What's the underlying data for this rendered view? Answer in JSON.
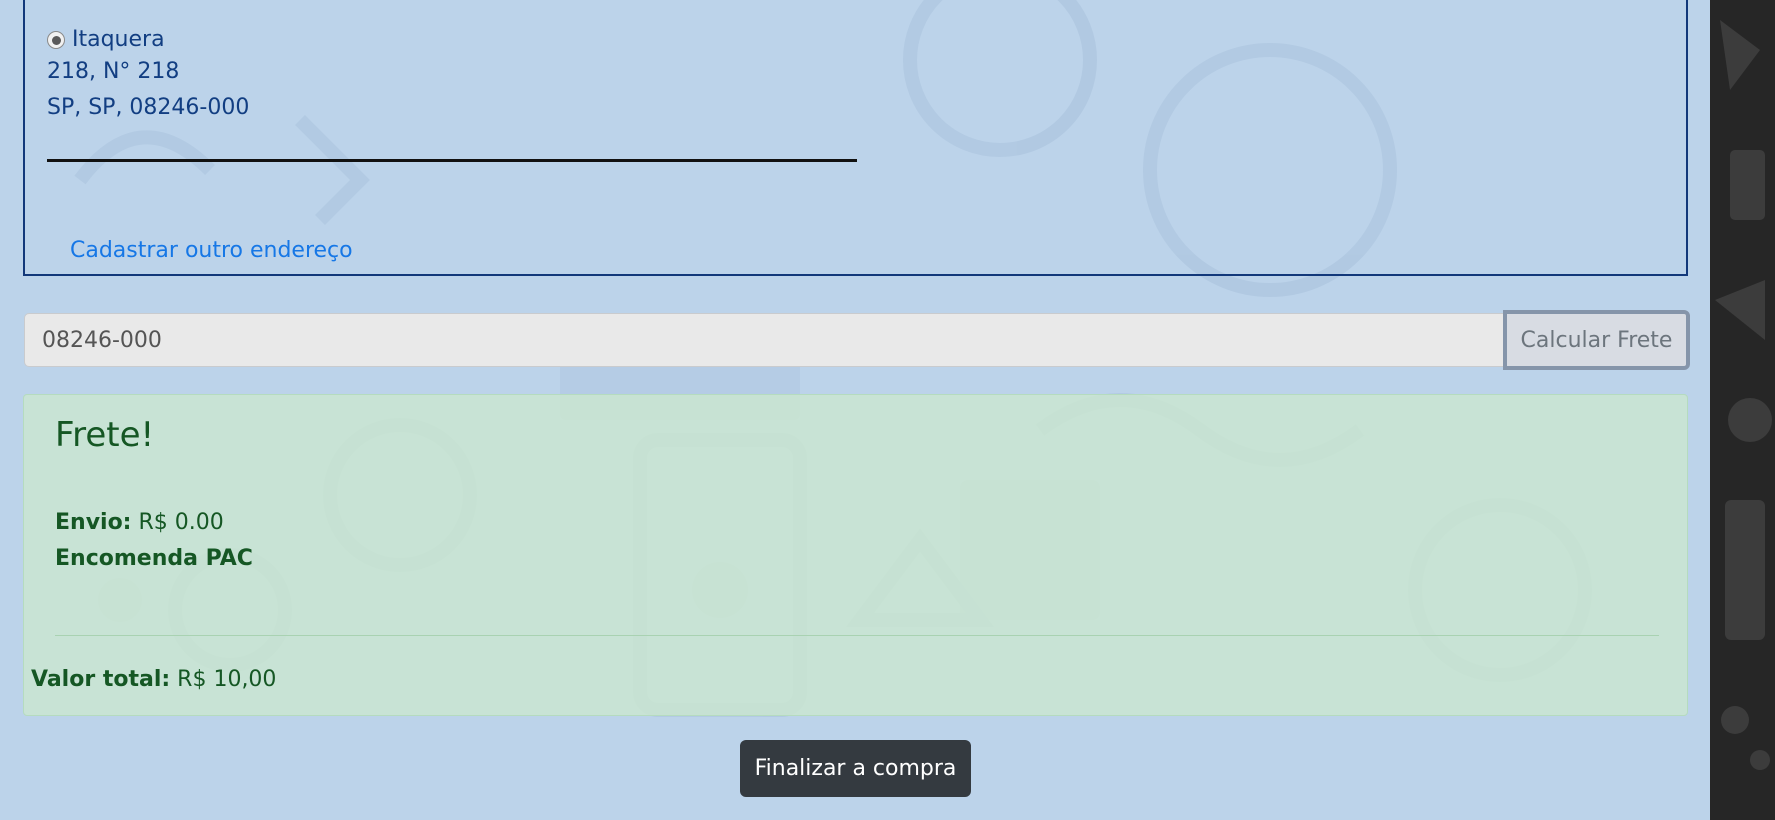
{
  "address": {
    "option_label": "Itaquera",
    "line1": "218, N° 218",
    "line2": "SP, SP, 08246-000",
    "new_address_link": "Cadastrar outro endereço"
  },
  "shipping_form": {
    "cep_value": "08246-000",
    "calculate_button": "Calcular Frete"
  },
  "frete_result": {
    "title": "Frete!",
    "envio_label": "Envio:",
    "envio_value": "R$ 0.00",
    "service": "Encomenda PAC",
    "total_label": "Valor total:",
    "total_value": "R$ 10,00"
  },
  "checkout": {
    "finish_button": "Finalizar a compra"
  },
  "colors": {
    "page_background": "#bcd3ea",
    "link": "#1677e6",
    "address_text": "#123e82",
    "success_text": "#155724",
    "dark_button": "#343a40"
  }
}
